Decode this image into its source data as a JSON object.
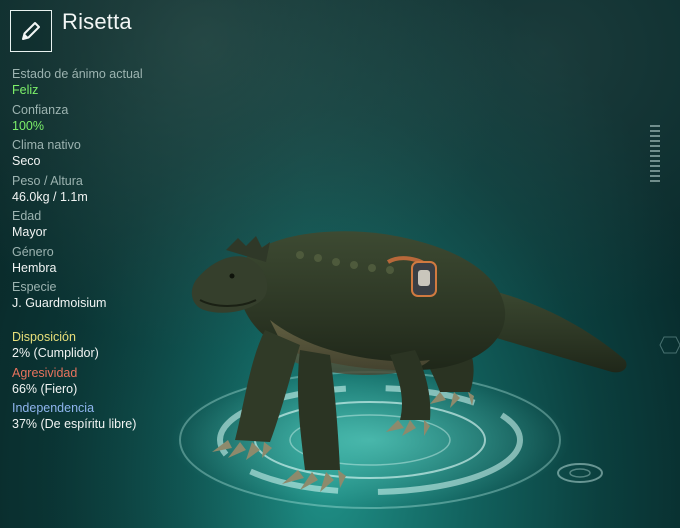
{
  "header": {
    "name": "Risetta",
    "edit_icon": "pencil-icon"
  },
  "stats": [
    {
      "label": "Estado de ánimo actual",
      "value": "Feliz",
      "highlight": true
    },
    {
      "label": "Confianza",
      "value": "100%",
      "highlight": true
    },
    {
      "label": "Clima nativo",
      "value": "Seco",
      "highlight": false
    },
    {
      "label": "Peso / Altura",
      "value": "46.0kg / 1.1m",
      "highlight": false
    },
    {
      "label": "Edad",
      "value": "Mayor",
      "highlight": false
    },
    {
      "label": "Género",
      "value": "Hembra",
      "highlight": false
    },
    {
      "label": "Especie",
      "value": "J. Guardmoisium",
      "highlight": false
    }
  ],
  "traits": [
    {
      "label": "Disposición",
      "value": "2% (Cumplidor)",
      "color": "#e8df7a"
    },
    {
      "label": "Agresividad",
      "value": "66% (Fiero)",
      "color": "#e8735d"
    },
    {
      "label": "Independencia",
      "value": "37% (De espíritu libre)",
      "color": "#8fb5ee"
    }
  ],
  "colors": {
    "highlight_green": "#7cf06a",
    "label_gray": "#9cb3b0",
    "background_teal": "#12635f"
  }
}
